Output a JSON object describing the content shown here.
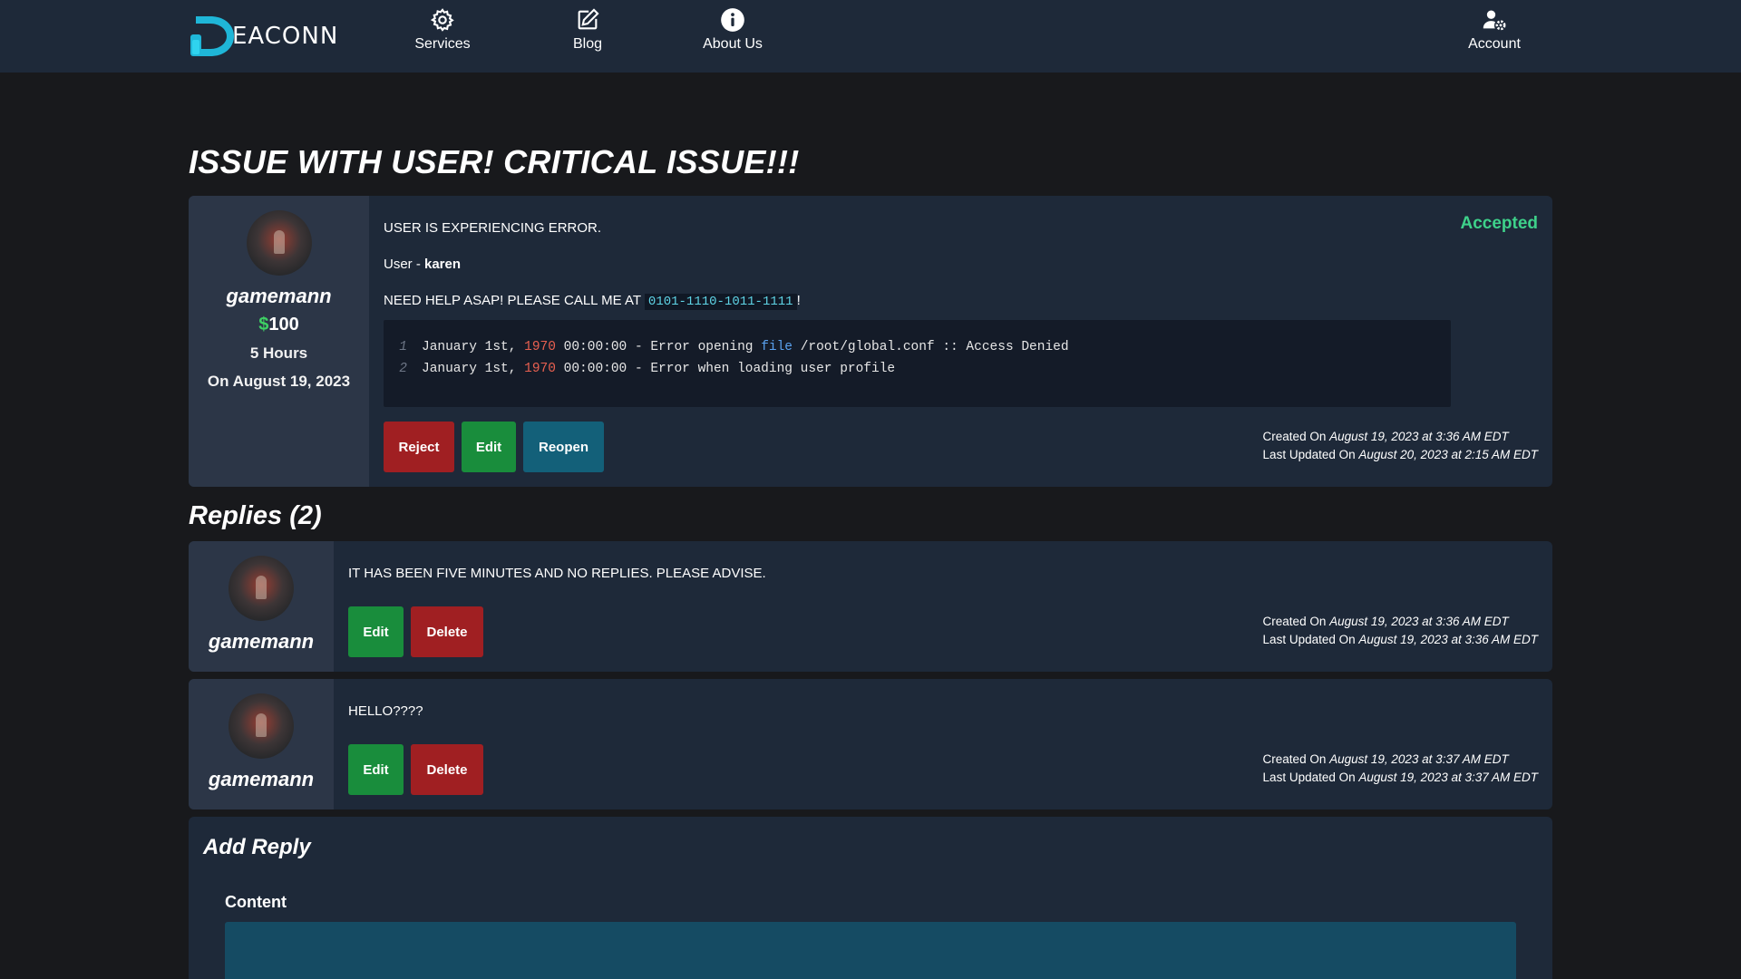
{
  "nav": {
    "logo_text": "EACONN",
    "items": [
      {
        "label": "Services",
        "icon": "gear-icon"
      },
      {
        "label": "Blog",
        "icon": "edit-icon"
      },
      {
        "label": "About Us",
        "icon": "info-icon"
      }
    ],
    "account": {
      "label": "Account",
      "icon": "user-cog-icon"
    }
  },
  "ticket": {
    "title": "ISSUE WITH USER! CRITICAL ISSUE!!!",
    "author": {
      "username": "gamemann",
      "currency": "$",
      "bounty": "100",
      "duration": "5 Hours",
      "date": "On August 19, 2023"
    },
    "status": "Accepted",
    "description": "USER IS EXPERIENCING ERROR.",
    "user_label": "User - ",
    "user_value": "karen",
    "help_prefix": "NEED HELP ASAP! PLEASE CALL ME AT ",
    "phone": "0101-1110-1011-1111",
    "help_suffix": "!",
    "code": [
      {
        "num": "1",
        "a": "January 1st, ",
        "year": "1970",
        "b": " 00:00:00 - Error opening ",
        "kw": "file",
        "c": " /root/global.conf :: Access Denied"
      },
      {
        "num": "2",
        "a": "January 1st, ",
        "year": "1970",
        "b": " 00:00:00 - Error when loading user profile",
        "kw": "",
        "c": ""
      }
    ],
    "buttons": {
      "reject": "Reject",
      "edit": "Edit",
      "reopen": "Reopen"
    },
    "created_label": "Created On ",
    "created_value": "August 19, 2023 at 3:36 AM EDT",
    "updated_label": "Last Updated On ",
    "updated_value": "August 20, 2023 at 2:15 AM EDT"
  },
  "replies": {
    "heading": "Replies (2)",
    "items": [
      {
        "username": "gamemann",
        "text": "IT HAS BEEN FIVE MINUTES AND NO REPLIES. PLEASE ADVISE.",
        "edit_label": "Edit",
        "delete_label": "Delete",
        "created_label": "Created On ",
        "created_value": "August 19, 2023 at 3:36 AM EDT",
        "updated_label": "Last Updated On ",
        "updated_value": "August 19, 2023 at 3:36 AM EDT"
      },
      {
        "username": "gamemann",
        "text": "HELLO????",
        "edit_label": "Edit",
        "delete_label": "Delete",
        "created_label": "Created On ",
        "created_value": "August 19, 2023 at 3:37 AM EDT",
        "updated_label": "Last Updated On ",
        "updated_value": "August 19, 2023 at 3:37 AM EDT"
      }
    ]
  },
  "add_reply": {
    "title": "Add Reply",
    "content_label": "Content",
    "content_value": ""
  },
  "colors": {
    "nav_bg": "#1e2939",
    "page_bg": "#18191c",
    "status_accepted": "#3ed18a",
    "btn_red": "#a01f22",
    "btn_green": "#198d3c",
    "btn_teal": "#136079"
  }
}
